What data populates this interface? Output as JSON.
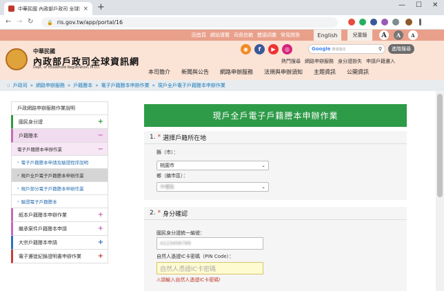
{
  "browser": {
    "tab_title": "中華民國 內政部戶政司 全球資訊網",
    "tab_close": "×",
    "new_tab": "+",
    "url": "ris.gov.tw/app/portal/16",
    "nav_back": "←",
    "nav_forward": "→",
    "nav_reload": "↻",
    "lock": "🔒",
    "window_minimize": "—",
    "window_maximize": "☐",
    "window_close": "✕"
  },
  "header": {
    "top_links": [
      "回首頁",
      "網站導覽",
      "司長信箱",
      "雙語詞彙",
      "常見問答"
    ],
    "english_label": "English",
    "kids_label": "兒童版",
    "font_buttons": [
      "A",
      "A",
      "A"
    ],
    "logo_small": "中華民國",
    "logo_title": "內政部戶政司全球資訊網",
    "logo_en": "Dept. of Household Registration, M.O.I.",
    "social_icons": [
      "rss-icon",
      "facebook-icon",
      "youtube-icon",
      "flickr-icon"
    ],
    "search_google": "Google",
    "search_placeholder": "搜尋強化",
    "adv_search": "進階搜尋",
    "quick_links": [
      "熱門搜尋",
      "網路申辦服務",
      "身分證掛失",
      "申請戶籍遷入"
    ],
    "main_nav": [
      "本司簡介",
      "新聞與公告",
      "網路申辦服務",
      "法規與申辦須知",
      "主題資訊",
      "公開資訊"
    ]
  },
  "breadcrumb": [
    "戶政司",
    "網路申辦服務",
    "戶籍謄本",
    "電子戶籍謄本申辦作業",
    "現戶全戶電子戶籍謄本申辦作業"
  ],
  "sidebar": {
    "items": [
      {
        "label": "戶政網路申辦服務作業說明"
      },
      {
        "label": "國民身分證",
        "plus": "+"
      },
      {
        "label": "戶籍謄本",
        "minus": "−"
      },
      {
        "label": "電子戶籍謄本申辦作業",
        "minus": "−"
      },
      {
        "label": "電子戶籍謄本申請及驗證程序說明"
      },
      {
        "label": "現戶全戶電子戶籍謄本申辦作業"
      },
      {
        "label": "現戶部分電子戶籍謄本申辦作業"
      },
      {
        "label": "驗證電子戶籍謄本"
      },
      {
        "label": "紙本戶籍謄本申辦作業",
        "plus": "+"
      },
      {
        "label": "繼承案件戶籍謄本申請",
        "plus": "+"
      },
      {
        "label": "大宗戶籍謄本申請",
        "plus": "+"
      },
      {
        "label": "電子遷徙紀錄證明書申辦作業",
        "plus": "+"
      }
    ],
    "chevron": "›"
  },
  "form": {
    "title": "現戶全戶電子戶籍謄本申辦作業",
    "section1": {
      "number": "1.",
      "required": "*",
      "title": "選擇戶籍所在地"
    },
    "county_label": "縣（市）：",
    "county_value": "桃園市",
    "district_label": "鄉（鎮市區）：",
    "district_value": "中壢區",
    "select_arrow": "⌄",
    "section2": {
      "number": "2.",
      "required": "*",
      "title": "身分確認"
    },
    "id_label": "國民身分證統一編號：",
    "id_value": "A123456789",
    "pin_label": "自然人憑證IC卡密碼（PIN Code）：",
    "pin_placeholder": "自然人憑證IC卡密碼",
    "pin_warning": "⚠請輸入自然人憑證IC卡密碼!"
  }
}
